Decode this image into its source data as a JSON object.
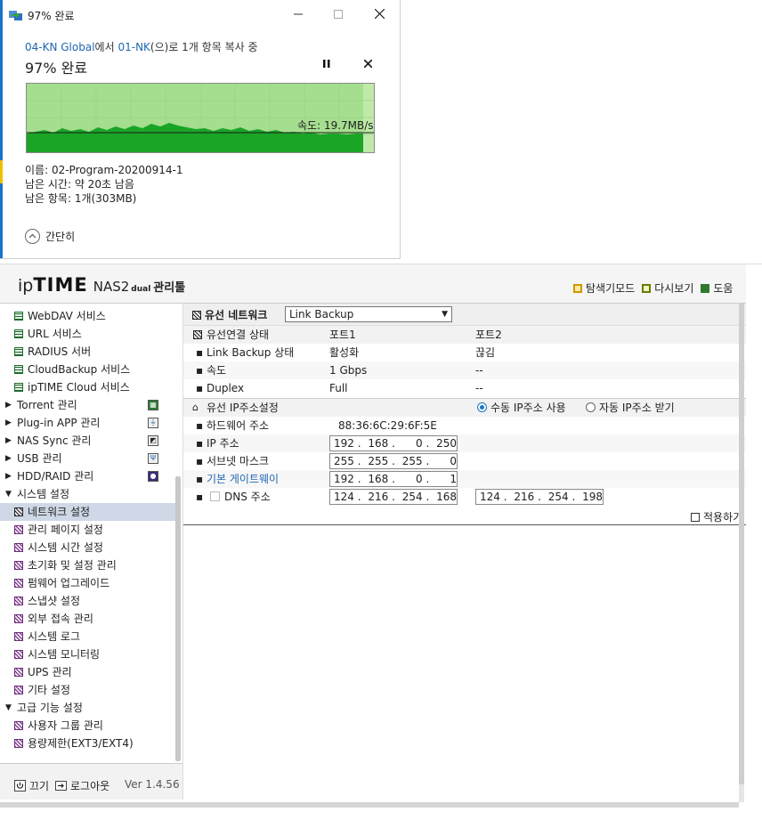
{
  "copy_dialog": {
    "title": "97% 완료",
    "source": "04-KN Global",
    "source_suffix": "에서",
    "dest": "01-NK",
    "dest_suffix": "(으)로 1개 항목 복사 중",
    "percent_label": "97% 완료",
    "progress_fraction": 0.97,
    "speed": "속도: 19.7MB/s",
    "name_line": "이름: 02-Program-20200914-1",
    "time_left_line": "남은 시간: 약 20초 남음",
    "items_left_line": "남은 항목: 1개(303MB)",
    "collapse_label": "간단히",
    "colors": {
      "graph_bg": "#bfe9a9",
      "graph_fill": "#1aa527",
      "link": "#1f66b0"
    }
  },
  "nas": {
    "brand": {
      "ip": "ip",
      "time": "TIME",
      "model": "NAS2",
      "dual": "dual",
      "suffix": "관리툴"
    },
    "header_links": [
      {
        "label": "탐색기모드",
        "icon": "folder-icon",
        "color": "#c99a00"
      },
      {
        "label": "다시보기",
        "icon": "refresh-icon",
        "color": "#6b7a00"
      },
      {
        "label": "도움",
        "icon": "help-icon",
        "color": "#2d7a2d"
      }
    ],
    "sidebar": {
      "items": [
        {
          "label": "WebDAV 서비스",
          "type": "sub",
          "icon": "green"
        },
        {
          "label": "URL 서비스",
          "type": "sub",
          "icon": "green"
        },
        {
          "label": "RADIUS 서버",
          "type": "sub",
          "icon": "green"
        },
        {
          "label": "CloudBackup 서비스",
          "type": "sub",
          "icon": "green"
        },
        {
          "label": "ipTIME Cloud 서비스",
          "type": "sub",
          "icon": "green"
        },
        {
          "label": "Torrent 관리",
          "type": "group",
          "right_icon": "torrent-icon"
        },
        {
          "label": "Plug-in APP 관리",
          "type": "group",
          "right_icon": "plugin-icon"
        },
        {
          "label": "NAS Sync 관리",
          "type": "group",
          "right_icon": "sync-icon"
        },
        {
          "label": "USB 관리",
          "type": "group",
          "right_icon": "usb-icon"
        },
        {
          "label": "HDD/RAID 관리",
          "type": "group",
          "right_icon": "disk-icon"
        },
        {
          "label": "시스템 설정",
          "type": "group-open"
        },
        {
          "label": "네트워크 설정",
          "type": "sub",
          "icon": "dark",
          "selected": true
        },
        {
          "label": "관리 페이지 설정",
          "type": "sub",
          "icon": "purple"
        },
        {
          "label": "시스템 시간 설정",
          "type": "sub",
          "icon": "purple"
        },
        {
          "label": "초기화 및 설정 관리",
          "type": "sub",
          "icon": "purple"
        },
        {
          "label": "펌웨어 업그레이드",
          "type": "sub",
          "icon": "purple"
        },
        {
          "label": "스냅샷 설정",
          "type": "sub",
          "icon": "purple"
        },
        {
          "label": "외부 접속 관리",
          "type": "sub",
          "icon": "purple"
        },
        {
          "label": "시스템 로그",
          "type": "sub",
          "icon": "purple"
        },
        {
          "label": "시스템 모니터링",
          "type": "sub",
          "icon": "purple"
        },
        {
          "label": "UPS 관리",
          "type": "sub",
          "icon": "purple"
        },
        {
          "label": "기타 설정",
          "type": "sub",
          "icon": "purple"
        },
        {
          "label": "고급 기능 설정",
          "type": "group-open"
        },
        {
          "label": "사용자 그룹 관리",
          "type": "sub",
          "icon": "purple"
        },
        {
          "label": "용량제한(EXT3/EXT4)",
          "type": "sub",
          "icon": "purple"
        }
      ]
    },
    "footer": {
      "power": "끄기",
      "logout": "로그아웃",
      "version": "Ver 1.4.56"
    },
    "content": {
      "wired_network_label": "유선 네트워크",
      "network_select": "Link Backup",
      "conn_header": {
        "title": "유선연결 상태",
        "port1": "포트1",
        "port2": "포트2"
      },
      "conn_rows": [
        {
          "label": "Link Backup 상태",
          "port1": "활성화",
          "port2": "끊김"
        },
        {
          "label": "속도",
          "port1": "1 Gbps",
          "port2": "--"
        },
        {
          "label": "Duplex",
          "port1": "Full",
          "port2": "--"
        }
      ],
      "ip_header": {
        "title": "유선 IP주소설정",
        "manual": "수동 IP주소 사용",
        "auto": "자동 IP주소 받기"
      },
      "mac_label": "하드웨어 주소",
      "mac_value": "88:36:6C:29:6F:5E",
      "ip_label": "IP 주소",
      "ip_value": [
        "192",
        "168",
        "0",
        "250"
      ],
      "subnet_label": "서브넷 마스크",
      "subnet_value": [
        "255",
        "255",
        "255",
        "0"
      ],
      "gateway_label": "기본 게이트웨이",
      "gateway_value": [
        "192",
        "168",
        "0",
        "1"
      ],
      "dns_label": "DNS 주소",
      "dns1_value": [
        "124",
        "216",
        "254",
        "168"
      ],
      "dns2_value": [
        "124",
        "216",
        "254",
        "198"
      ],
      "apply_label": "적용하기",
      "colors": {
        "gateway_link": "#1f66b0",
        "radio_on": "#1a73c7"
      }
    }
  }
}
